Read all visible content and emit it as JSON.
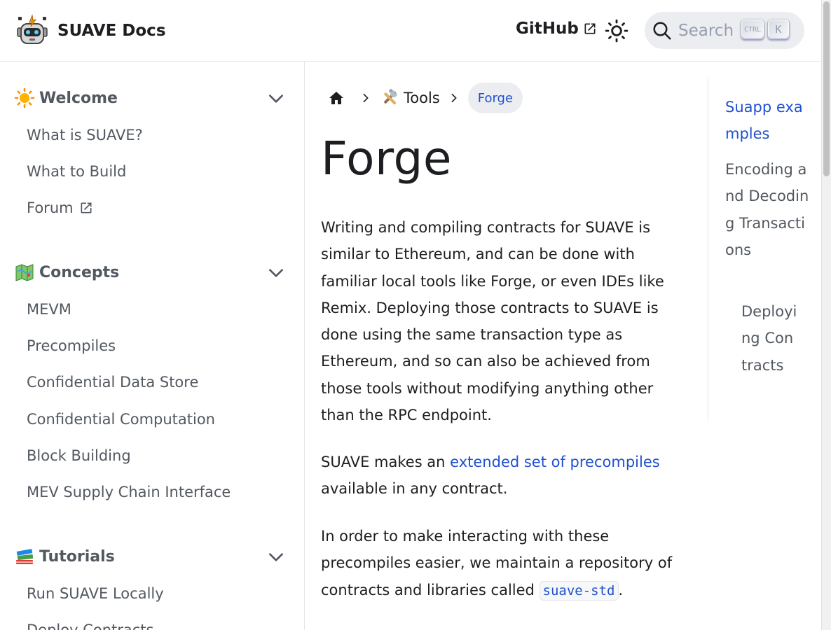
{
  "navbar": {
    "brand_title": "SUAVE Docs",
    "github_label": "GitHub",
    "search_placeholder": "Search",
    "search_kbd_ctrl": "CTRL",
    "search_kbd_k": "K"
  },
  "sidebar": {
    "categories": [
      {
        "label": "Welcome",
        "icon": "sun-emoji",
        "items": [
          "What is SUAVE?",
          "What to Build",
          "Forum"
        ]
      },
      {
        "label": "Concepts",
        "icon": "map-emoji",
        "items": [
          "MEVM",
          "Precompiles",
          "Confidential Data Store",
          "Confidential Computation",
          "Block Building",
          "MEV Supply Chain Interface"
        ]
      },
      {
        "label": "Tutorials",
        "icon": "books-emoji",
        "items": [
          "Run SUAVE Locally",
          "Deploy Contracts"
        ]
      }
    ]
  },
  "breadcrumbs": {
    "home_icon": "home-icon",
    "tools_label": "Tools",
    "current": "Forge"
  },
  "article": {
    "title": "Forge",
    "p1": "Writing and compiling contracts for SUAVE is similar to Ethereum, and can be done with familiar local tools like Forge, or even IDEs like Remix. Deploying those contracts to SUAVE is done using the same transaction type as Ethereum, and so can also be achieved from those tools without modifying anything other than the RPC endpoint.",
    "p2_before": "SUAVE makes an ",
    "p2_link": "extended set of precompiles",
    "p2_after": " available in any contract.",
    "p3_before": "In order to make interacting with these precompiles easier, we maintain a repository of contracts and libraries called ",
    "p3_code": "suave-std",
    "p3_after": "."
  },
  "toc": {
    "items": [
      "Suapp examples",
      "Encoding and Decoding Transactions",
      "Deploying Contracts"
    ]
  },
  "colors": {
    "link": "#2050d0",
    "text": "#1c1e21",
    "muted": "#525860"
  }
}
